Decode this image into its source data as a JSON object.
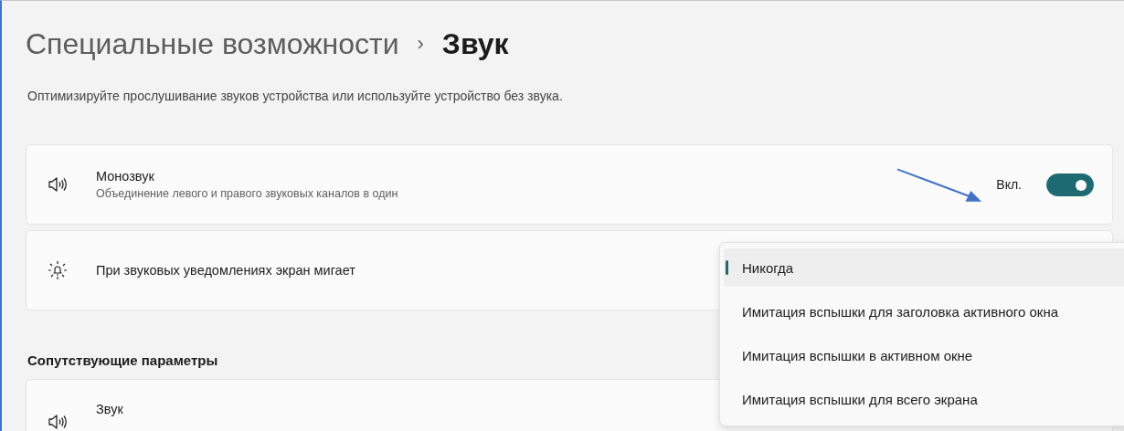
{
  "breadcrumb": [
    {
      "label": "Специальные возможности",
      "current": false
    },
    {
      "label": "Звук",
      "current": true
    }
  ],
  "breadcrumb_separator": "›",
  "description": "Оптимизируйте прослушивание звуков устройства или используйте устройство без звука.",
  "settings": [
    {
      "kind": "toggle",
      "title": "Монозвук",
      "subtitle": "Объединение левого и правого звуковых каналов в один",
      "state_label": "Вкл.",
      "on": true
    },
    {
      "kind": "dropdown",
      "title": "При звуковых уведомлениях экран мигает",
      "options": [
        {
          "label": "Никогда",
          "selected": true
        },
        {
          "label": "Имитация вспышки для заголовка активного окна",
          "selected": false
        },
        {
          "label": "Имитация вспышки в активном окне",
          "selected": false
        },
        {
          "label": "Имитация вспышки для всего экрана",
          "selected": false
        }
      ]
    }
  ],
  "related": {
    "heading": "Сопутствующие параметры",
    "items": [
      {
        "title": "Звук"
      }
    ]
  }
}
